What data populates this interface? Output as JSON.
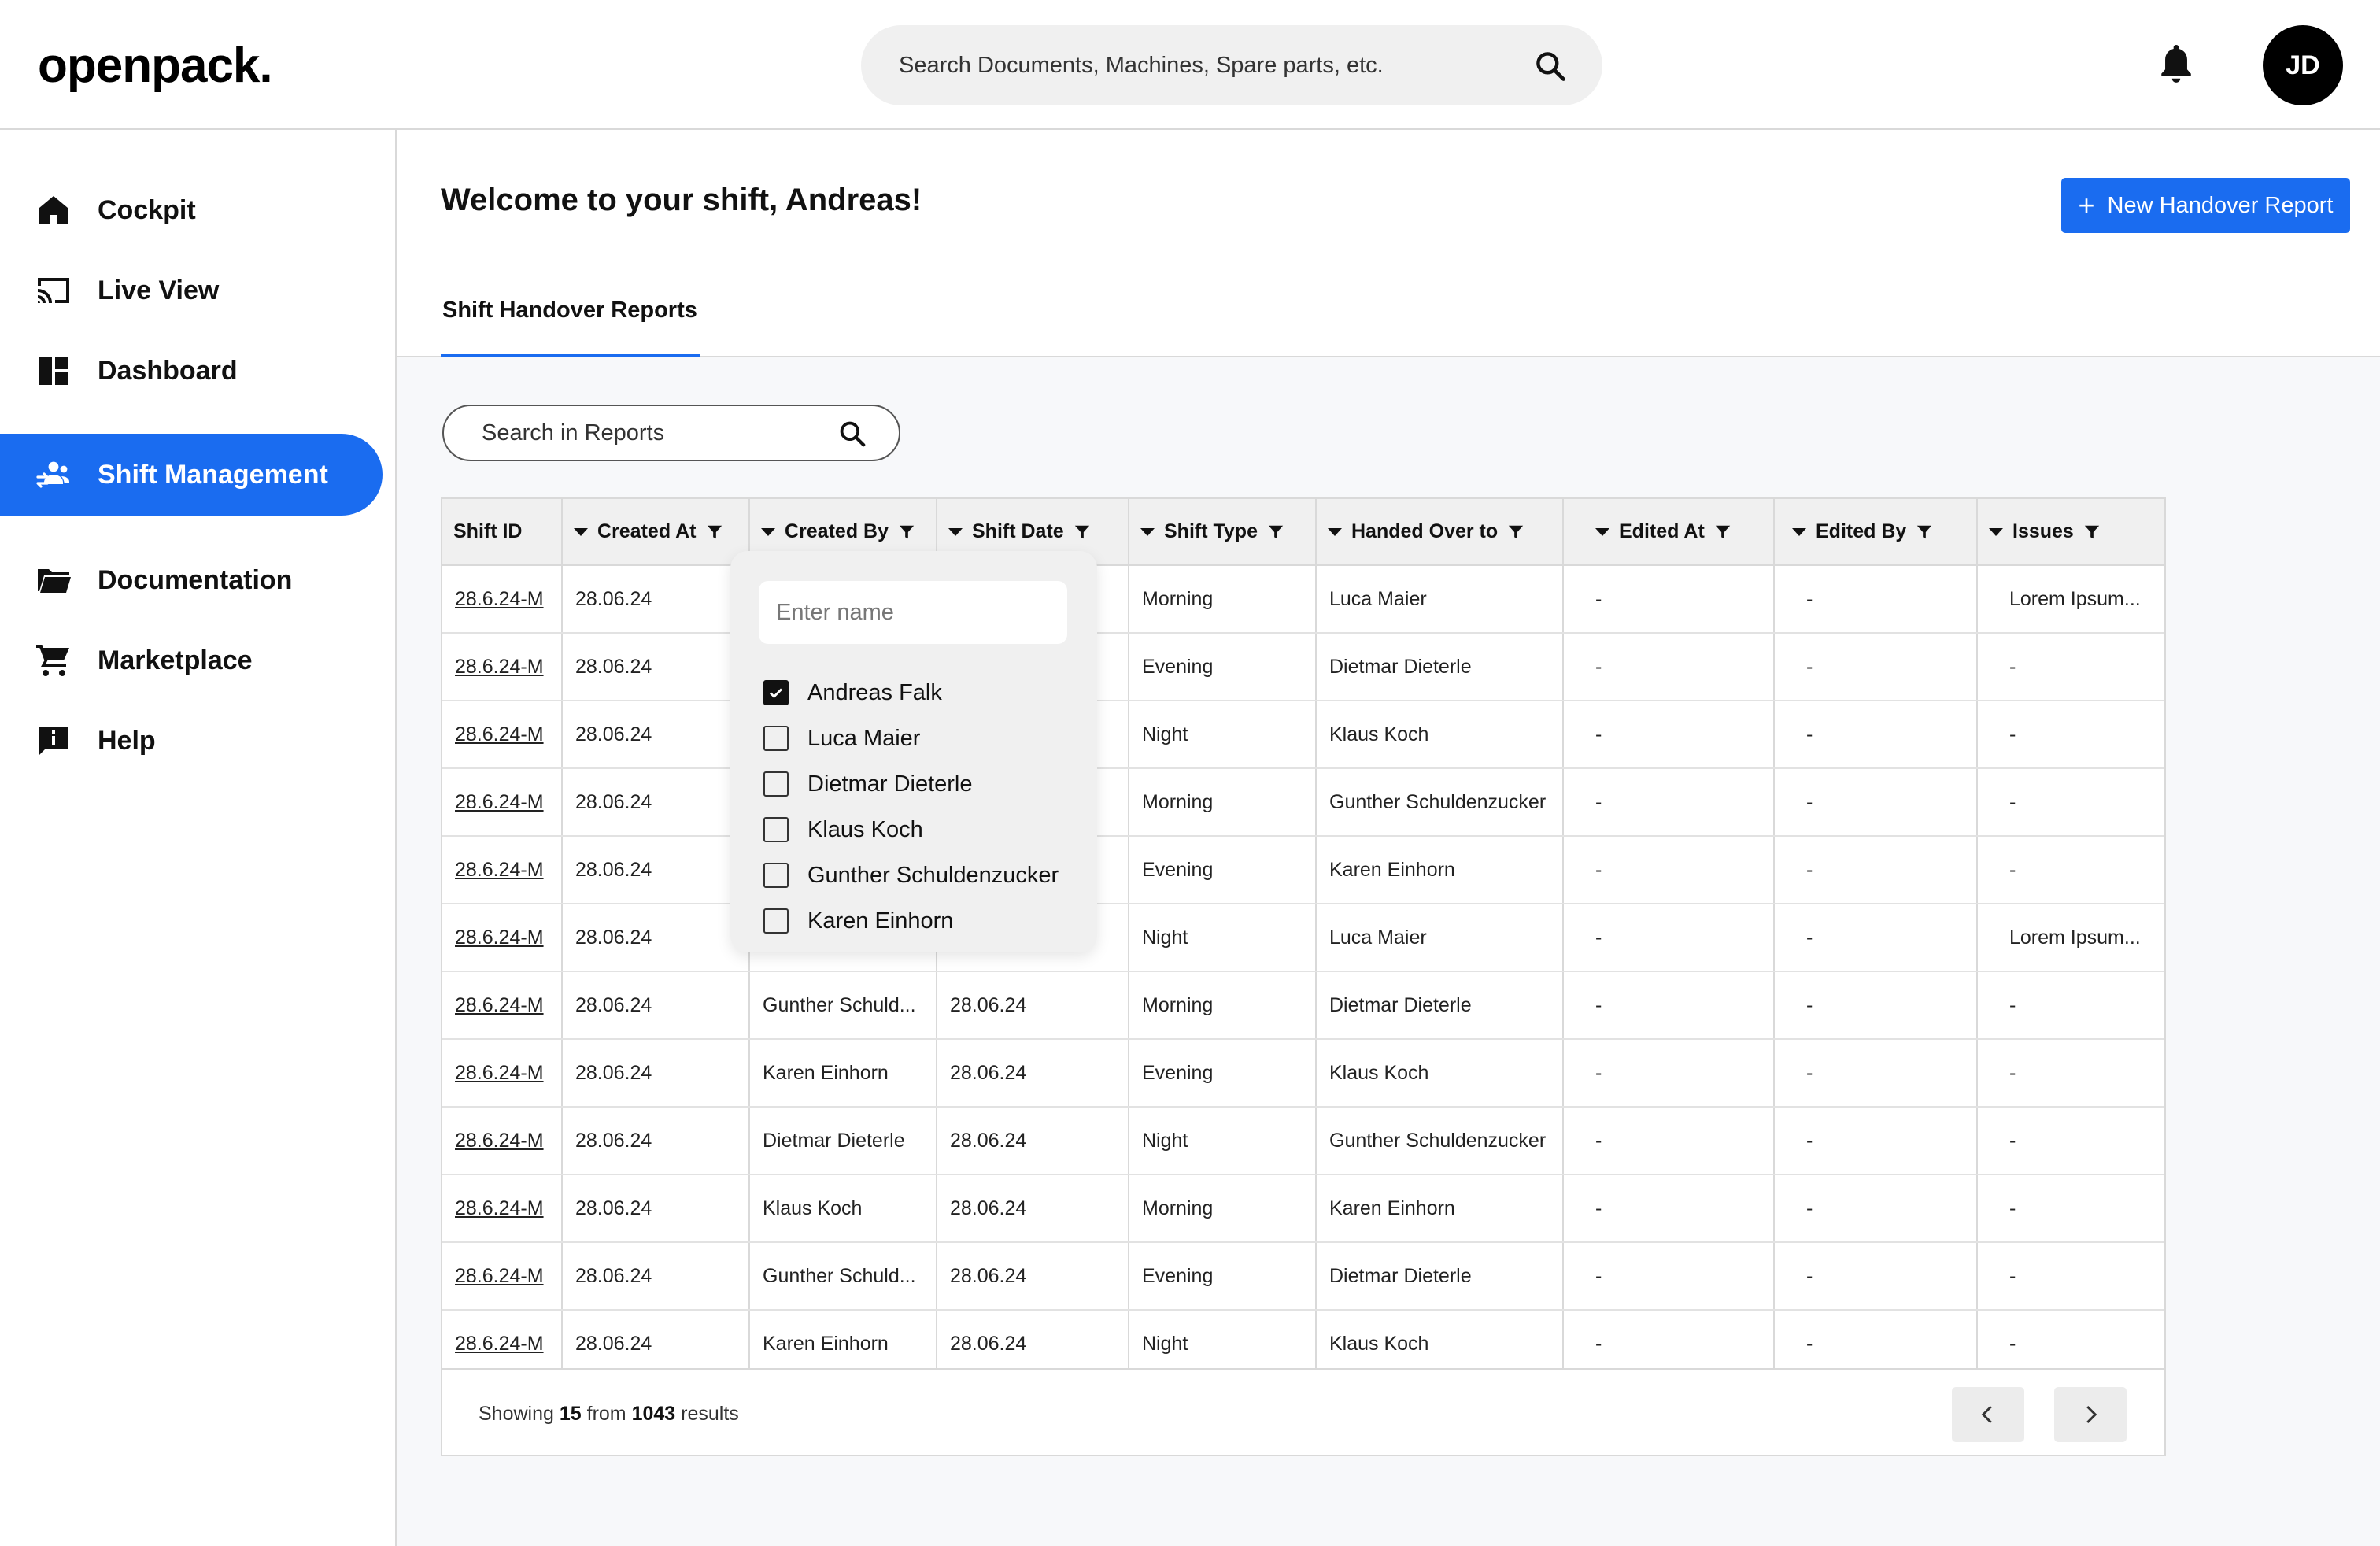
{
  "header": {
    "logo": "openpack.",
    "search_placeholder": "Search Documents, Machines, Spare parts, etc.",
    "avatar_initials": "JD"
  },
  "sidebar": {
    "items": [
      {
        "label": "Cockpit",
        "icon": "home-icon"
      },
      {
        "label": "Live View",
        "icon": "cast-icon"
      },
      {
        "label": "Dashboard",
        "icon": "dashboard-icon"
      },
      {
        "label": "Shift Management",
        "icon": "team-icon",
        "active": true
      },
      {
        "label": "Documentation",
        "icon": "folder-icon"
      },
      {
        "label": "Marketplace",
        "icon": "cart-icon"
      },
      {
        "label": "Help",
        "icon": "help-icon"
      }
    ]
  },
  "main": {
    "welcome": "Welcome to your shift, Andreas!",
    "new_report_label": "New Handover Report",
    "tab_label": "Shift Handover Reports",
    "report_search_placeholder": "Search in Reports"
  },
  "table": {
    "columns": [
      "Shift ID",
      "Created At",
      "Created By",
      "Shift Date",
      "Shift Type",
      "Handed Over to",
      "Edited At",
      "Edited By",
      "Issues"
    ],
    "rows": [
      [
        "28.6.24-M",
        "28.06.24",
        "",
        "",
        "Morning",
        "Luca Maier",
        "-",
        "-",
        "Lorem Ipsum..."
      ],
      [
        "28.6.24-M",
        "28.06.24",
        "",
        "",
        "Evening",
        "Dietmar Dieterle",
        "-",
        "-",
        "-"
      ],
      [
        "28.6.24-M",
        "28.06.24",
        "",
        "",
        "Night",
        "Klaus Koch",
        "-",
        "-",
        "-"
      ],
      [
        "28.6.24-M",
        "28.06.24",
        "",
        "",
        "Morning",
        "Gunther Schuldenzucker",
        "-",
        "-",
        "-"
      ],
      [
        "28.6.24-M",
        "28.06.24",
        "",
        "",
        "Evening",
        "Karen Einhorn",
        "-",
        "-",
        "-"
      ],
      [
        "28.6.24-M",
        "28.06.24",
        "",
        "",
        "Night",
        "Luca Maier",
        "-",
        "-",
        "Lorem Ipsum..."
      ],
      [
        "28.6.24-M",
        "28.06.24",
        "Gunther Schuld...",
        "28.06.24",
        "Morning",
        "Dietmar Dieterle",
        "-",
        "-",
        "-"
      ],
      [
        "28.6.24-M",
        "28.06.24",
        "Karen Einhorn",
        "28.06.24",
        "Evening",
        "Klaus Koch",
        "-",
        "-",
        "-"
      ],
      [
        "28.6.24-M",
        "28.06.24",
        "Dietmar Dieterle",
        "28.06.24",
        "Night",
        "Gunther Schuldenzucker",
        "-",
        "-",
        "-"
      ],
      [
        "28.6.24-M",
        "28.06.24",
        "Klaus Koch",
        "28.06.24",
        "Morning",
        "Karen Einhorn",
        "-",
        "-",
        "-"
      ],
      [
        "28.6.24-M",
        "28.06.24",
        "Gunther Schuld...",
        "28.06.24",
        "Evening",
        "Dietmar Dieterle",
        "-",
        "-",
        "-"
      ],
      [
        "28.6.24-M",
        "28.06.24",
        "Karen Einhorn",
        "28.06.24",
        "Night",
        "Klaus Koch",
        "-",
        "-",
        "-"
      ]
    ],
    "footer": {
      "prefix": "Showing",
      "shown": "15",
      "middle": "from",
      "total": "1043",
      "suffix": "results"
    }
  },
  "created_by_filter": {
    "placeholder": "Enter name",
    "options": [
      {
        "label": "Andreas Falk",
        "checked": true
      },
      {
        "label": "Luca Maier",
        "checked": false
      },
      {
        "label": "Dietmar Dieterle",
        "checked": false
      },
      {
        "label": "Klaus Koch",
        "checked": false
      },
      {
        "label": "Gunther Schuldenzucker",
        "checked": false
      },
      {
        "label": "Karen Einhorn",
        "checked": false
      }
    ]
  },
  "colors": {
    "accent": "#1a6cf0",
    "header_bg": "#f0f0f0"
  }
}
